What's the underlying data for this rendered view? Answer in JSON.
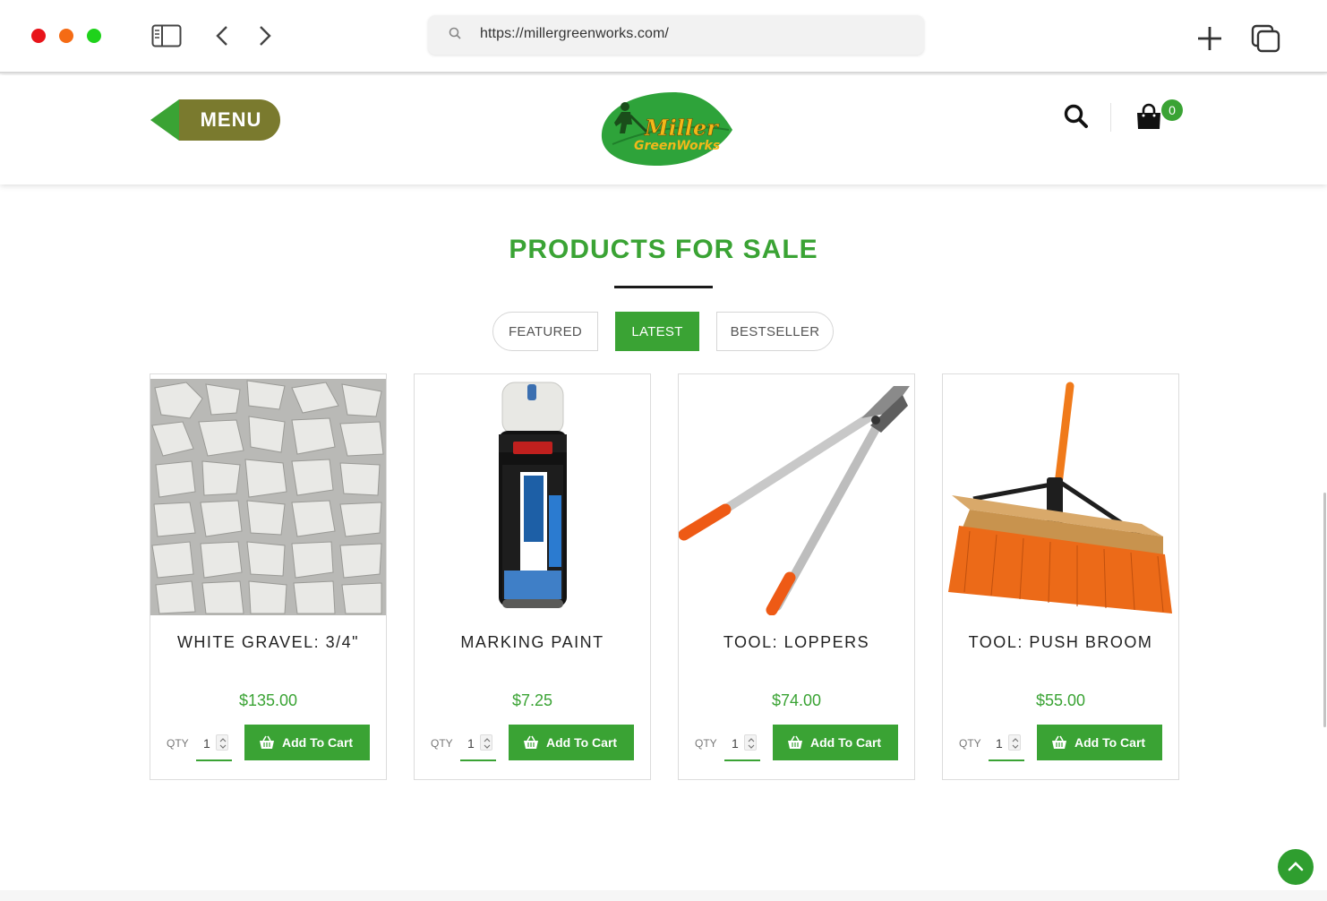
{
  "browser": {
    "url": "https://millergreenworks.com/",
    "icons": {
      "sidebar": "sidebar-icon",
      "back": "chevron-left-icon",
      "forward": "chevron-right-icon",
      "search": "search-icon",
      "new_tab": "plus-icon",
      "tabs": "tabs-icon"
    },
    "traffic_lights": [
      "#e8141a",
      "#f56b14",
      "#1fd21b"
    ]
  },
  "header": {
    "menu_label": "MENU",
    "logo_text_1": "Miller",
    "logo_text_2": "GreenWorks",
    "cart_count": "0",
    "icons": {
      "search": "search-icon",
      "cart": "shopping-bag-icon"
    }
  },
  "section": {
    "title": "PRODUCTS FOR SALE",
    "tabs": [
      {
        "label": "FEATURED",
        "active": false
      },
      {
        "label": "LATEST",
        "active": true
      },
      {
        "label": "BESTSELLER",
        "active": false
      }
    ]
  },
  "products": [
    {
      "name": "WHITE GRAVEL: 3/4\"",
      "price": "$135.00",
      "qty_label": "QTY",
      "qty": "1",
      "button": "Add To Cart",
      "image": "white-gravel"
    },
    {
      "name": "MARKING PAINT",
      "price": "$7.25",
      "qty_label": "QTY",
      "qty": "1",
      "button": "Add To Cart",
      "image": "spray-paint-can"
    },
    {
      "name": "TOOL: LOPPERS",
      "price": "$74.00",
      "qty_label": "QTY",
      "qty": "1",
      "button": "Add To Cart",
      "image": "loppers"
    },
    {
      "name": "TOOL: PUSH BROOM",
      "price": "$55.00",
      "qty_label": "QTY",
      "qty": "1",
      "button": "Add To Cart",
      "image": "push-broom"
    }
  ],
  "colors": {
    "brand_green": "#3aa334",
    "menu_olive": "#7a7a2e",
    "menu_arrow": "#3aa334"
  }
}
